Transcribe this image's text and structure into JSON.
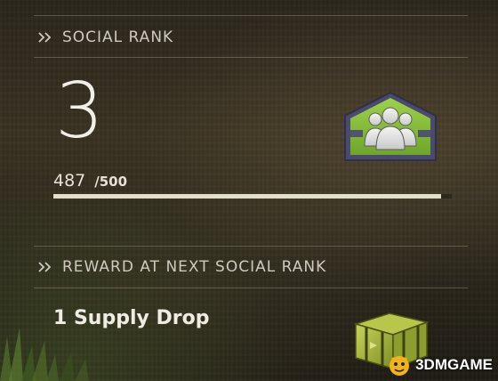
{
  "social_rank": {
    "header": "SOCIAL RANK",
    "rank": "3",
    "progress_current": "487",
    "progress_max": "/500",
    "progress_fraction": 0.974,
    "badge_icon": "social-rank-badge-icon"
  },
  "reward": {
    "header": "REWARD AT NEXT SOCIAL RANK",
    "item": "1 Supply Drop",
    "item_icon": "supply-crate-icon"
  },
  "watermark": {
    "text": "3DMGAME"
  },
  "colors": {
    "badge_green": "#8cc63f",
    "badge_frame": "#4a4a6e",
    "crate_green": "#a3b83a",
    "progress_fill": "#e4dfca"
  }
}
